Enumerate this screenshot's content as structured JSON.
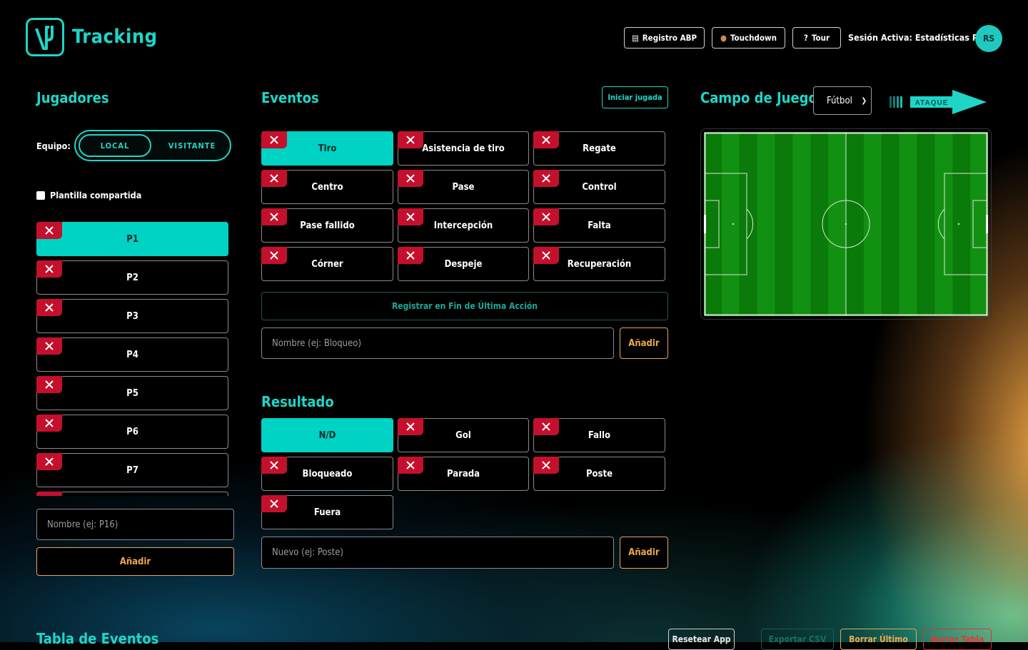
{
  "app": {
    "title": "Tracking"
  },
  "header": {
    "buttons": [
      {
        "icon": "clipboard-icon",
        "label": "Registro ABP"
      },
      {
        "icon": "football-icon",
        "label": "Touchdown"
      },
      {
        "icon": "question-icon",
        "label": "Tour"
      }
    ],
    "session": "Sesión Activa: Estadísticas Pro",
    "avatar": "RS"
  },
  "players": {
    "title": "Jugadores",
    "team_label": "Equipo:",
    "teams": [
      "LOCAL",
      "VISITANTE"
    ],
    "active_team": "LOCAL",
    "shared_roster_label": "Plantilla compartida",
    "items": [
      "P1",
      "P2",
      "P3",
      "P4",
      "P5",
      "P6",
      "P7"
    ],
    "selected": "P1",
    "name_placeholder": "Nombre (ej: P16)",
    "add_label": "Añadir"
  },
  "events": {
    "title": "Eventos",
    "start_play_label": "Iniciar jugada",
    "items": [
      "Tiro",
      "Asistencia de tiro",
      "Regate",
      "Centro",
      "Pase",
      "Control",
      "Pase fallido",
      "Intercepción",
      "Falta",
      "Córner",
      "Despeje",
      "Recuperación"
    ],
    "selected": "Tiro",
    "register_end_label": "Registrar en Fin de Última Acción",
    "name_placeholder": "Nombre (ej: Bloqueo)",
    "add_label": "Añadir"
  },
  "result": {
    "title": "Resultado",
    "items": [
      "N/D",
      "Gol",
      "Fallo",
      "Bloqueado",
      "Parada",
      "Poste",
      "Fuera"
    ],
    "selected": "N/D",
    "name_placeholder": "Nuevo (ej: Poste)",
    "add_label": "Añadir"
  },
  "field": {
    "title": "Campo de Juego",
    "sport_selected": "Fútbol",
    "attack_label": "ATAQUE",
    "colors": {
      "grass_dark": "#0a7a0a",
      "grass_light": "#129012",
      "lines": "#d8e8d8"
    }
  },
  "table": {
    "title": "Tabla de Eventos",
    "buttons": [
      "Resetear App",
      "Exportar CSV",
      "Borrar Último",
      "Borrar Tabla"
    ]
  },
  "colors": {
    "accent": "#1ed6c8",
    "danger": "#c4102c",
    "warning": "#f0a84a"
  }
}
